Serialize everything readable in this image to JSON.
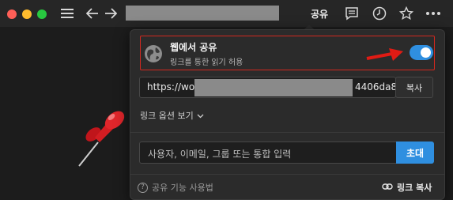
{
  "toolbar": {
    "share_label": "공유"
  },
  "share_popup": {
    "web_share": {
      "title": "웹에서 공유",
      "subtitle": "링크를 통한 읽기 허용",
      "enabled": true
    },
    "link": {
      "url_prefix": "https://wo",
      "url_suffix": "4406da8",
      "copy_label": "복사"
    },
    "link_options_label": "링크 옵션 보기",
    "invite": {
      "placeholder": "사용자, 이메일, 그룹 또는 통합 입력",
      "button_label": "초대"
    },
    "footer": {
      "help_label": "공유 기능 사용법",
      "copy_link_label": "링크 복사"
    }
  },
  "colors": {
    "accent": "#2f8fe0",
    "highlight_border": "#d2281f"
  }
}
